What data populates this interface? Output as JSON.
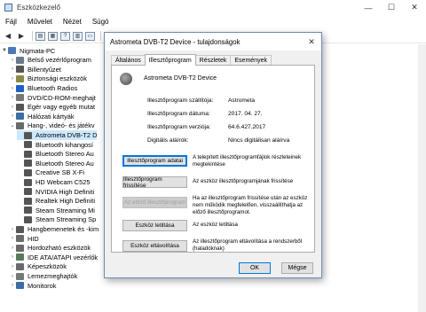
{
  "window": {
    "title": "Eszközkezelő",
    "minimize": "—",
    "maximize": "☐",
    "close": "✕"
  },
  "menu": [
    "Fájl",
    "Művelet",
    "Nézet",
    "Súgó"
  ],
  "tree": [
    {
      "label": "Nigmata-PC",
      "indent": 0,
      "arrow": "▼",
      "color": "#4a7ab5"
    },
    {
      "label": "Belső vezérlőprogram",
      "indent": 1,
      "arrow": "›",
      "color": "#6a7a8a"
    },
    {
      "label": "Billentyűzet",
      "indent": 1,
      "arrow": "›",
      "color": "#555"
    },
    {
      "label": "Biztonsági eszközök",
      "indent": 1,
      "arrow": "›",
      "color": "#8a8a4a"
    },
    {
      "label": "Bluetooth Radios",
      "indent": 1,
      "arrow": "›",
      "color": "#1f5fc8"
    },
    {
      "label": "DVD/CD-ROM-meghajt",
      "indent": 1,
      "arrow": "›",
      "color": "#777"
    },
    {
      "label": "Egér vagy egyéb mutat",
      "indent": 1,
      "arrow": "›",
      "color": "#555"
    },
    {
      "label": "Hálózati kártyák",
      "indent": 1,
      "arrow": "›",
      "color": "#3a6ea5"
    },
    {
      "label": "Hang-, videó- és játékv",
      "indent": 1,
      "arrow": "⌄",
      "color": "#6a6a6a"
    },
    {
      "label": "Astrometa DVB-T2 D",
      "indent": 2,
      "arrow": "",
      "color": "#555",
      "selected": true
    },
    {
      "label": "Bluetooth kihangosí",
      "indent": 2,
      "arrow": "",
      "color": "#555"
    },
    {
      "label": "Bluetooth Stereo Au",
      "indent": 2,
      "arrow": "",
      "color": "#555"
    },
    {
      "label": "Bluetooth Stereo Au",
      "indent": 2,
      "arrow": "",
      "color": "#555"
    },
    {
      "label": "Creative SB X-Fi",
      "indent": 2,
      "arrow": "",
      "color": "#555"
    },
    {
      "label": "HD Webcam C525",
      "indent": 2,
      "arrow": "",
      "color": "#555"
    },
    {
      "label": "NVIDIA High Definiti",
      "indent": 2,
      "arrow": "",
      "color": "#555"
    },
    {
      "label": "Realtek High Definiti",
      "indent": 2,
      "arrow": "",
      "color": "#555"
    },
    {
      "label": "Steam Streaming Mi",
      "indent": 2,
      "arrow": "",
      "color": "#555"
    },
    {
      "label": "Steam Streaming Sp",
      "indent": 2,
      "arrow": "",
      "color": "#555"
    },
    {
      "label": "Hangbemenetek és -kim",
      "indent": 1,
      "arrow": "›",
      "color": "#555"
    },
    {
      "label": "HID",
      "indent": 1,
      "arrow": "›",
      "color": "#6a6a6a"
    },
    {
      "label": "Hordozható eszközök",
      "indent": 1,
      "arrow": "›",
      "color": "#6a6a6a"
    },
    {
      "label": "IDE ATA/ATAPI vezérlők",
      "indent": 1,
      "arrow": "›",
      "color": "#5a7a5a"
    },
    {
      "label": "Képeszközök",
      "indent": 1,
      "arrow": "›",
      "color": "#6a6a6a"
    },
    {
      "label": "Lemezmeghajtók",
      "indent": 1,
      "arrow": "›",
      "color": "#777"
    },
    {
      "label": "Monitorok",
      "indent": 1,
      "arrow": "›",
      "color": "#3a6ea5"
    }
  ],
  "dialog": {
    "title": "Astrometa DVB-T2 Device - tulajdonságok",
    "close": "✕",
    "tabs": [
      "Általános",
      "Illesztőprogram",
      "Részletek",
      "Események"
    ],
    "active_tab": 1,
    "device_name": "Astrometa DVB-T2 Device",
    "properties": [
      {
        "label": "Illesztőprogram szállítója:",
        "value": "Astrometa"
      },
      {
        "label": "Illesztőprogram dátuma:",
        "value": "2017. 04. 27."
      },
      {
        "label": "Illesztőprogram verziója:",
        "value": "64.6.427.2017"
      },
      {
        "label": "Digitális aláírók:",
        "value": "Nincs digitálisan aláírva"
      }
    ],
    "actions": [
      {
        "button": "Illesztőprogram adatai",
        "desc": "A telepített illesztőprogramfájlok részleteinek megtekintése",
        "state": "primary"
      },
      {
        "button": "Illesztőprogram frissítése",
        "desc": "Az eszköz illesztőprogramjának frissítése",
        "state": "normal"
      },
      {
        "button": "Az előző illesztőprogram",
        "desc": "Ha az illesztőprogram frissítése után az eszköz nem működik megfelelően, visszaállíthatja az előző illesztőprogramot.",
        "state": "disabled"
      },
      {
        "button": "Eszköz letiltása",
        "desc": "Az eszköz letiltása",
        "state": "normal"
      },
      {
        "button": "Eszköz eltávolítása",
        "desc": "Az illesztőprogram eltávolítása a rendszerből (haladóknak)",
        "state": "normal"
      }
    ],
    "ok": "OK",
    "cancel": "Mégse"
  }
}
